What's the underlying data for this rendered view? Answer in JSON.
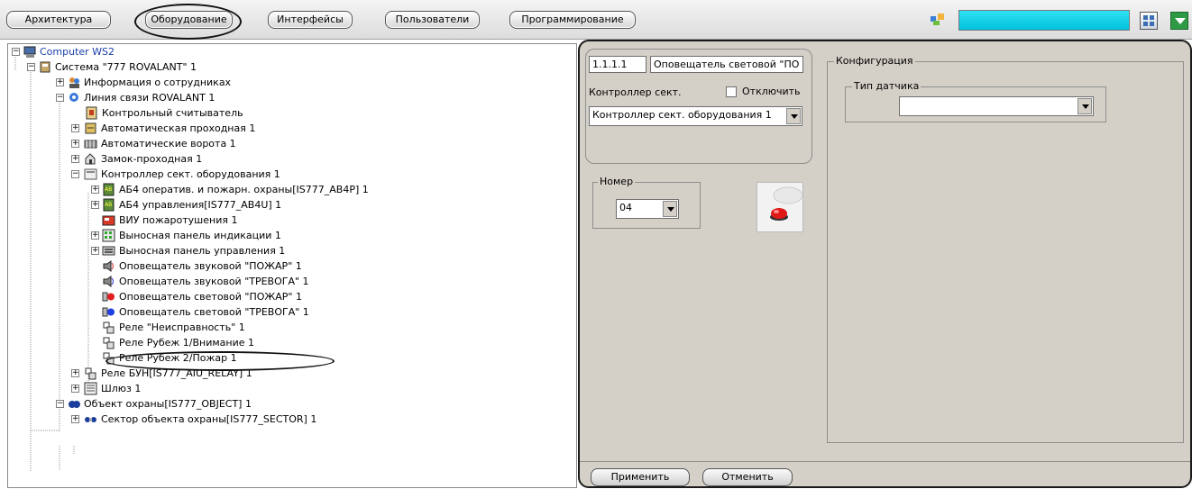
{
  "toolbar": {
    "tabs": [
      "Архитектура",
      "Оборудование",
      "Интерфейсы",
      "Пользователи",
      "Программирование"
    ],
    "active_tab": "Оборудование"
  },
  "tree": {
    "nodes": [
      {
        "label": "Computer WS2"
      },
      {
        "label": "Система \"777 ROVALANT\" 1"
      },
      {
        "label": "Информация о сотрудниках"
      },
      {
        "label": "Линия связи ROVALANT 1"
      },
      {
        "label": "Контрольный считыватель"
      },
      {
        "label": "Автоматическая проходная 1"
      },
      {
        "label": "Автоматические ворота 1"
      },
      {
        "label": "Замок-проходная 1"
      },
      {
        "label": "Контроллер сект. оборудования 1"
      },
      {
        "label": "АБ4 оператив. и пожарн. охраны[IS777_AB4P] 1"
      },
      {
        "label": "АБ4 управления[IS777_AB4U] 1"
      },
      {
        "label": "ВИУ пожаротушения 1"
      },
      {
        "label": "Выносная панель индикации 1"
      },
      {
        "label": "Выносная панель управления 1"
      },
      {
        "label": "Оповещатель звуковой \"ПОЖАР\" 1"
      },
      {
        "label": "Оповещатель звуковой \"ТРЕВОГА\" 1"
      },
      {
        "label": "Оповещатель световой \"ПОЖАР\" 1"
      },
      {
        "label": "Оповещатель световой \"ТРЕВОГА\" 1"
      },
      {
        "label": "Реле \"Неисправность\" 1"
      },
      {
        "label": "Реле Рубеж 1/Внимание 1"
      },
      {
        "label": "Реле Рубеж 2/Пожар 1"
      },
      {
        "label": "Реле БУН[IS777_AIU_RELAY] 1"
      },
      {
        "label": "Шлюз 1"
      },
      {
        "label": "Объект охраны[IS777_OBJECT] 1"
      },
      {
        "label": "Сектор объекта охраны[IS777_SECTOR] 1"
      }
    ]
  },
  "props": {
    "id_value": "1.1.1.1",
    "name_value": "Оповещатель световой \"ПО",
    "controller_label": "Контроллер сект.",
    "disable_label": "Отключить",
    "controller_value": "Контроллер сект. оборудования 1",
    "number_title": "Номер",
    "number_value": "04",
    "config_title": "Конфигурация",
    "sensor_type_title": "Тип датчика",
    "sensor_type_value": "",
    "apply_label": "Применить",
    "cancel_label": "Отменить"
  },
  "colors": {
    "accent_cyan": "#1fd6ee",
    "panel_bg": "#d4d0c8",
    "tree_label_blue": "#1a3fa8"
  }
}
